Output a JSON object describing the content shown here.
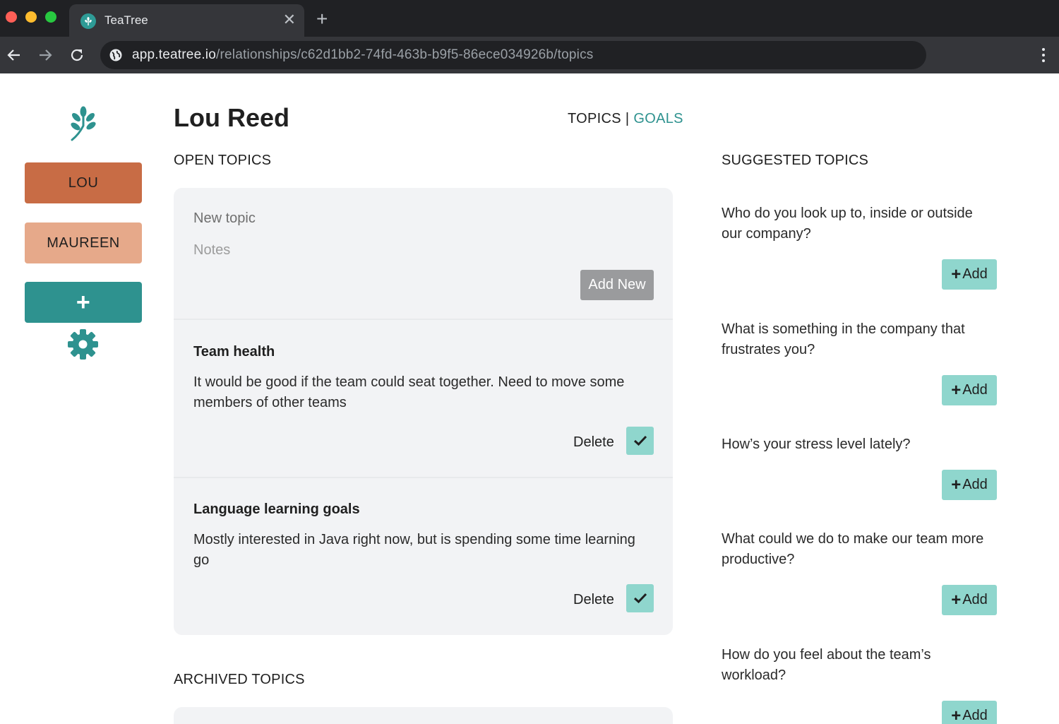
{
  "browser": {
    "tab_title": "TeaTree",
    "tab_close": "✕",
    "new_tab": "+",
    "url_host": "app.teatree.io",
    "url_path": "/relationships/c62d1bb2-74fd-463b-b9f5-86ece034926b/topics"
  },
  "sidebar": {
    "people": [
      {
        "label": "LOU",
        "color": "#c86c45"
      },
      {
        "label": "MAUREEN",
        "color": "#e6a98a"
      }
    ],
    "add_label": "+",
    "accent": "#2e928f"
  },
  "header": {
    "person_name": "Lou Reed",
    "topics_link": "TOPICS",
    "separator": "|",
    "goals_link": "GOALS"
  },
  "open_topics": {
    "title": "OPEN TOPICS",
    "new_topic_placeholder": "New topic",
    "notes_placeholder": "Notes",
    "add_new_label": "Add New",
    "items": [
      {
        "title": "Team health",
        "notes": "It would be good if the team could seat together. Need to move some members of other teams",
        "delete_label": "Delete"
      },
      {
        "title": "Language learning goals",
        "notes": "Mostly interested in Java right now, but is spending some time learning go",
        "delete_label": "Delete"
      }
    ]
  },
  "archived_topics": {
    "title": "ARCHIVED TOPICS"
  },
  "suggested_topics": {
    "title": "SUGGESTED TOPICS",
    "add_label": "Add",
    "items": [
      "Who do you look up to, inside or outside our company?",
      "What is something in the company that frustrates you?",
      "How’s your stress level lately?",
      "What could we do to make our team more productive?",
      "How do you feel about the team’s workload?"
    ]
  },
  "colors": {
    "brand_teal": "#2e928f",
    "light_teal": "#8fd6cd",
    "card_bg": "#f2f3f5"
  }
}
